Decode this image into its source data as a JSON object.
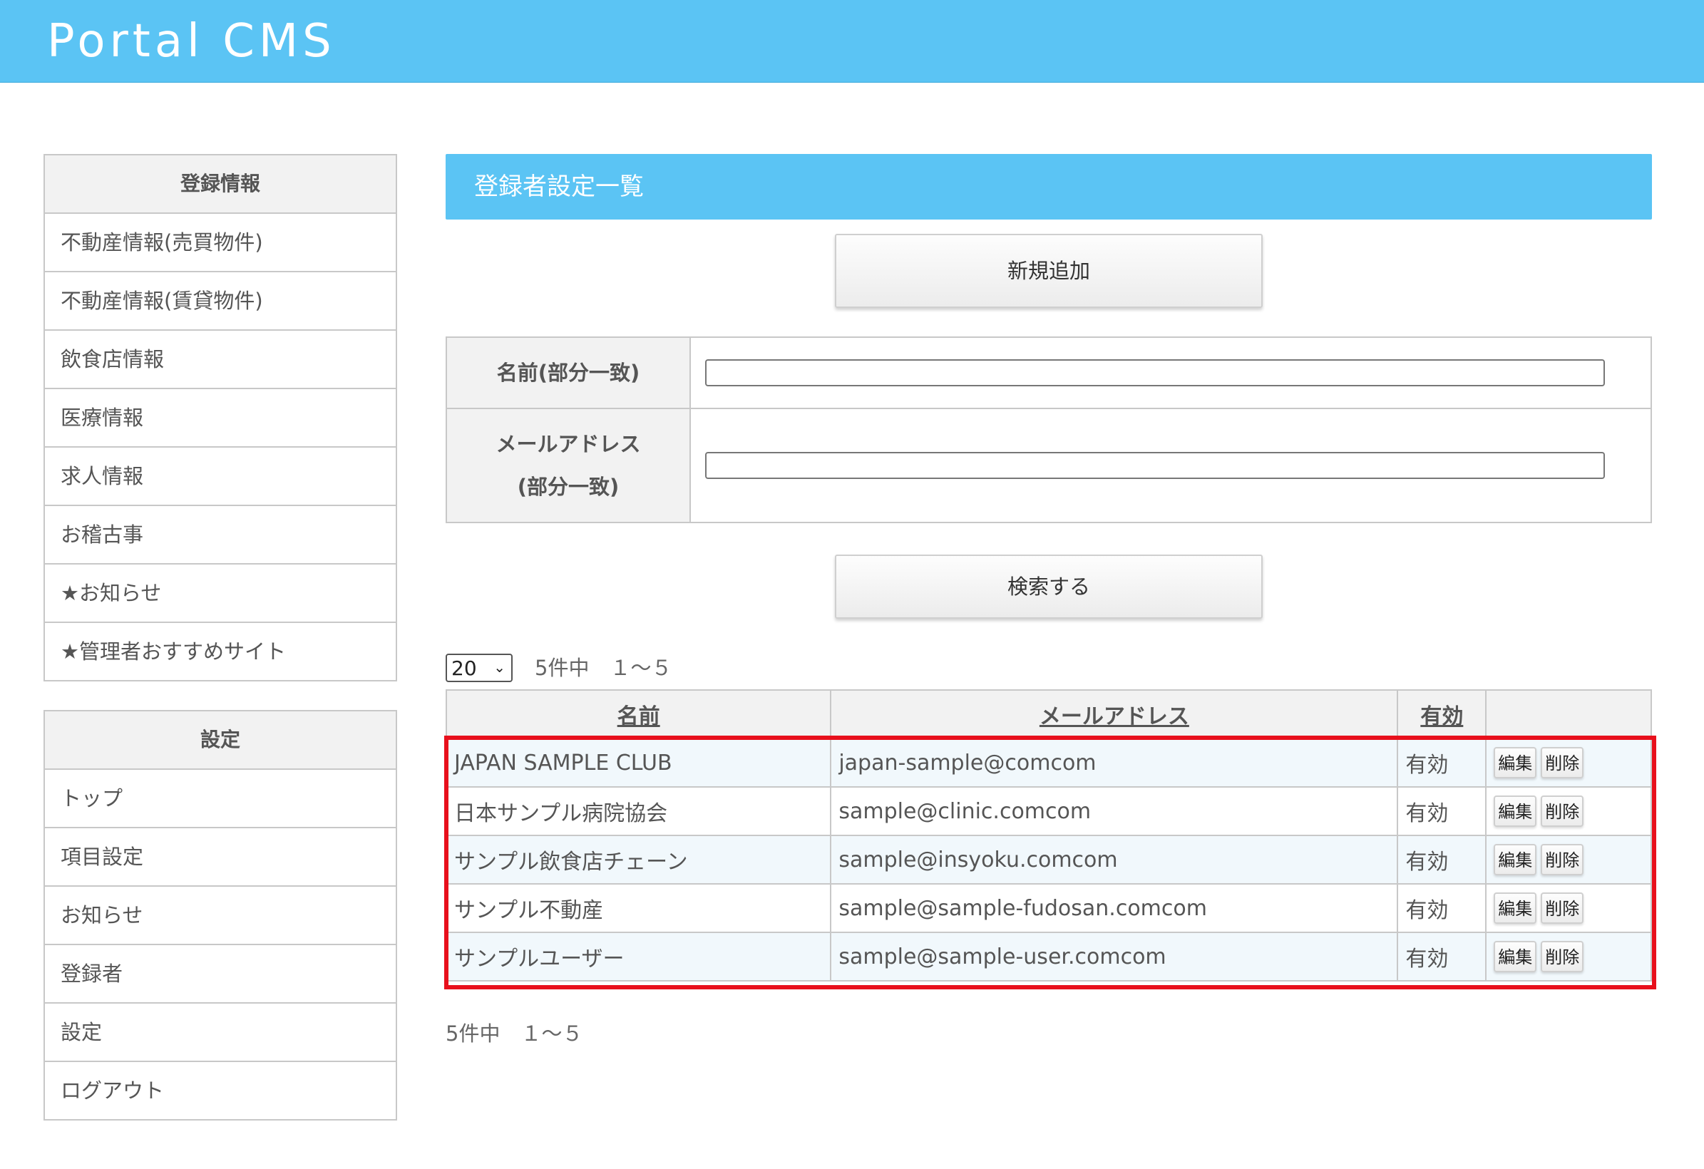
{
  "app": {
    "title": "Portal CMS"
  },
  "sidebar": {
    "sections": [
      {
        "heading": "登録情報",
        "items": [
          "不動産情報(売買物件)",
          "不動産情報(賃貸物件)",
          "飲食店情報",
          "医療情報",
          "求人情報",
          "お稽古事",
          "★お知らせ",
          "★管理者おすすめサイト"
        ]
      },
      {
        "heading": "設定",
        "items": [
          "トップ",
          "項目設定",
          "お知らせ",
          "登録者",
          "設定",
          "ログアウト"
        ]
      }
    ]
  },
  "main": {
    "title": "登録者設定一覧",
    "add_button": "新規追加",
    "search": {
      "name_label": "名前(部分一致)",
      "name_value": "",
      "email_label_line1": "メールアドレス",
      "email_label_line2": "(部分一致)",
      "email_value": "",
      "button": "検索する"
    },
    "pager": {
      "per_page": "20",
      "summary": "5件中　１～５"
    },
    "table": {
      "headers": [
        "名前",
        "メールアドレス",
        "有効",
        ""
      ],
      "edit_label": "編集",
      "delete_label": "削除",
      "rows": [
        {
          "name": "JAPAN SAMPLE CLUB",
          "email": "japan-sample@comcom",
          "status": "有効"
        },
        {
          "name": "日本サンプル病院協会",
          "email": "sample@clinic.comcom",
          "status": "有効"
        },
        {
          "name": "サンプル飲食店チェーン",
          "email": "sample@insyoku.comcom",
          "status": "有効"
        },
        {
          "name": "サンプル不動産",
          "email": "sample@sample-fudosan.comcom",
          "status": "有効"
        },
        {
          "name": "サンプルユーザー",
          "email": "sample@sample-user.comcom",
          "status": "有効"
        }
      ]
    },
    "bottom_summary": "5件中　１～５",
    "highlight_color": "#e8101c",
    "accent_color": "#5bc4f4"
  }
}
